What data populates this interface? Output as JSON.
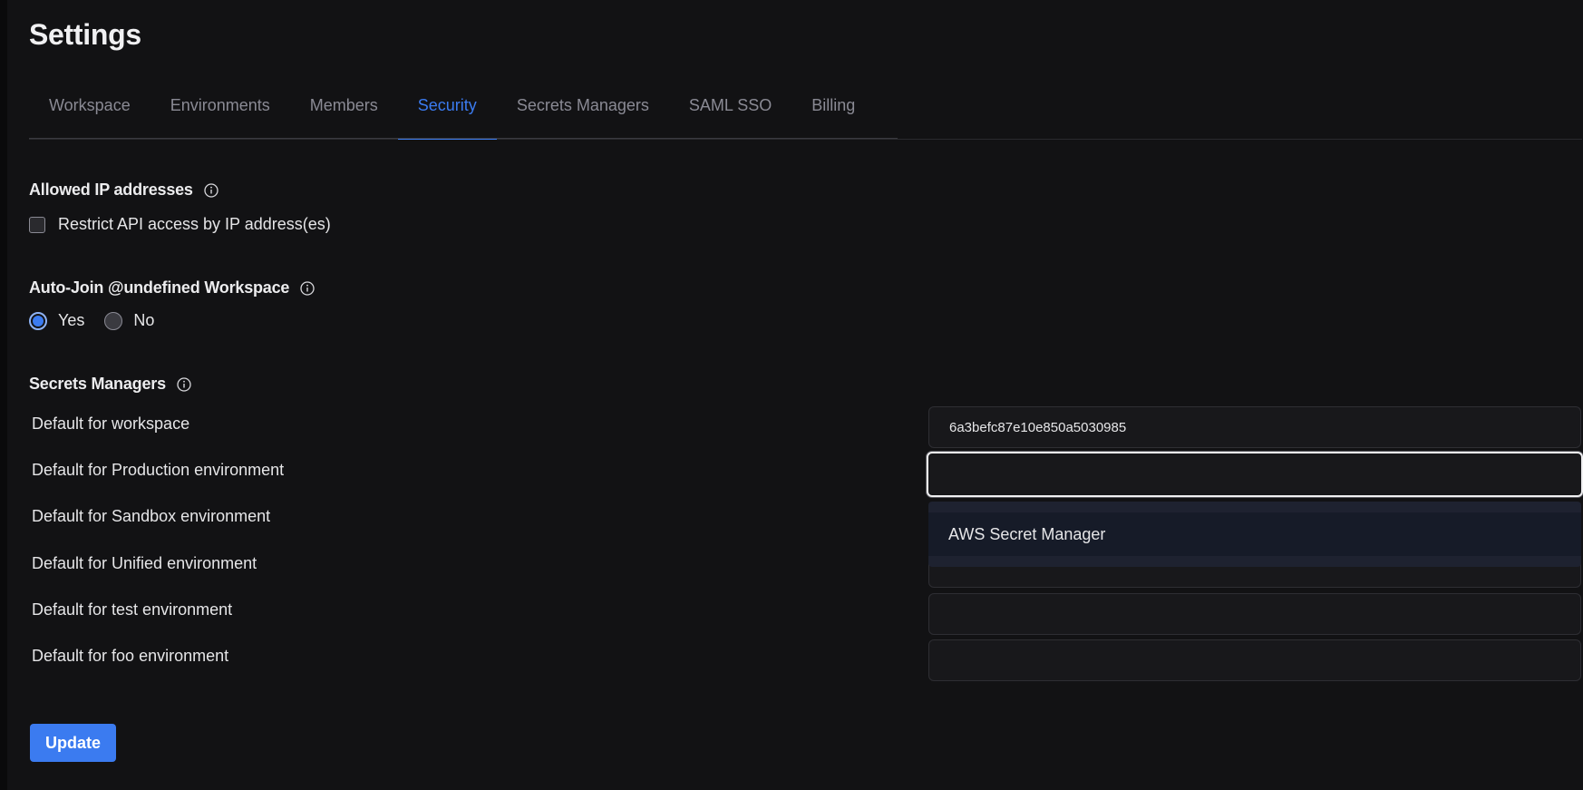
{
  "page": {
    "title": "Settings"
  },
  "tabs": [
    {
      "label": "Workspace",
      "active": false
    },
    {
      "label": "Environments",
      "active": false
    },
    {
      "label": "Members",
      "active": false
    },
    {
      "label": "Security",
      "active": true
    },
    {
      "label": "Secrets Managers",
      "active": false
    },
    {
      "label": "SAML SSO",
      "active": false
    },
    {
      "label": "Billing",
      "active": false
    }
  ],
  "allowed_ip": {
    "heading": "Allowed IP addresses",
    "info_icon": "info-icon",
    "checkbox_label": "Restrict API access by IP address(es)",
    "checked": false
  },
  "auto_join": {
    "heading": "Auto-Join @undefined Workspace",
    "info_icon": "info-icon",
    "options": [
      {
        "label": "Yes",
        "checked": true
      },
      {
        "label": "No",
        "checked": false
      }
    ]
  },
  "secrets_managers": {
    "heading": "Secrets Managers",
    "info_icon": "info-icon",
    "rows": [
      {
        "label": "Default for workspace",
        "value": "6a3befc87e10e850a5030985"
      },
      {
        "label": "Default for Production environment",
        "value": ""
      },
      {
        "label": "Default for Sandbox environment",
        "value": ""
      },
      {
        "label": "Default for Unified environment",
        "value": ""
      },
      {
        "label": "Default for test environment",
        "value": ""
      },
      {
        "label": "Default for foo environment",
        "value": ""
      }
    ],
    "dropdown_options": [
      "AWS Secret Manager"
    ]
  },
  "actions": {
    "update_label": "Update"
  },
  "colors": {
    "background": "#121214",
    "accent": "#3b7bf0",
    "muted_text": "#8a8a94"
  }
}
